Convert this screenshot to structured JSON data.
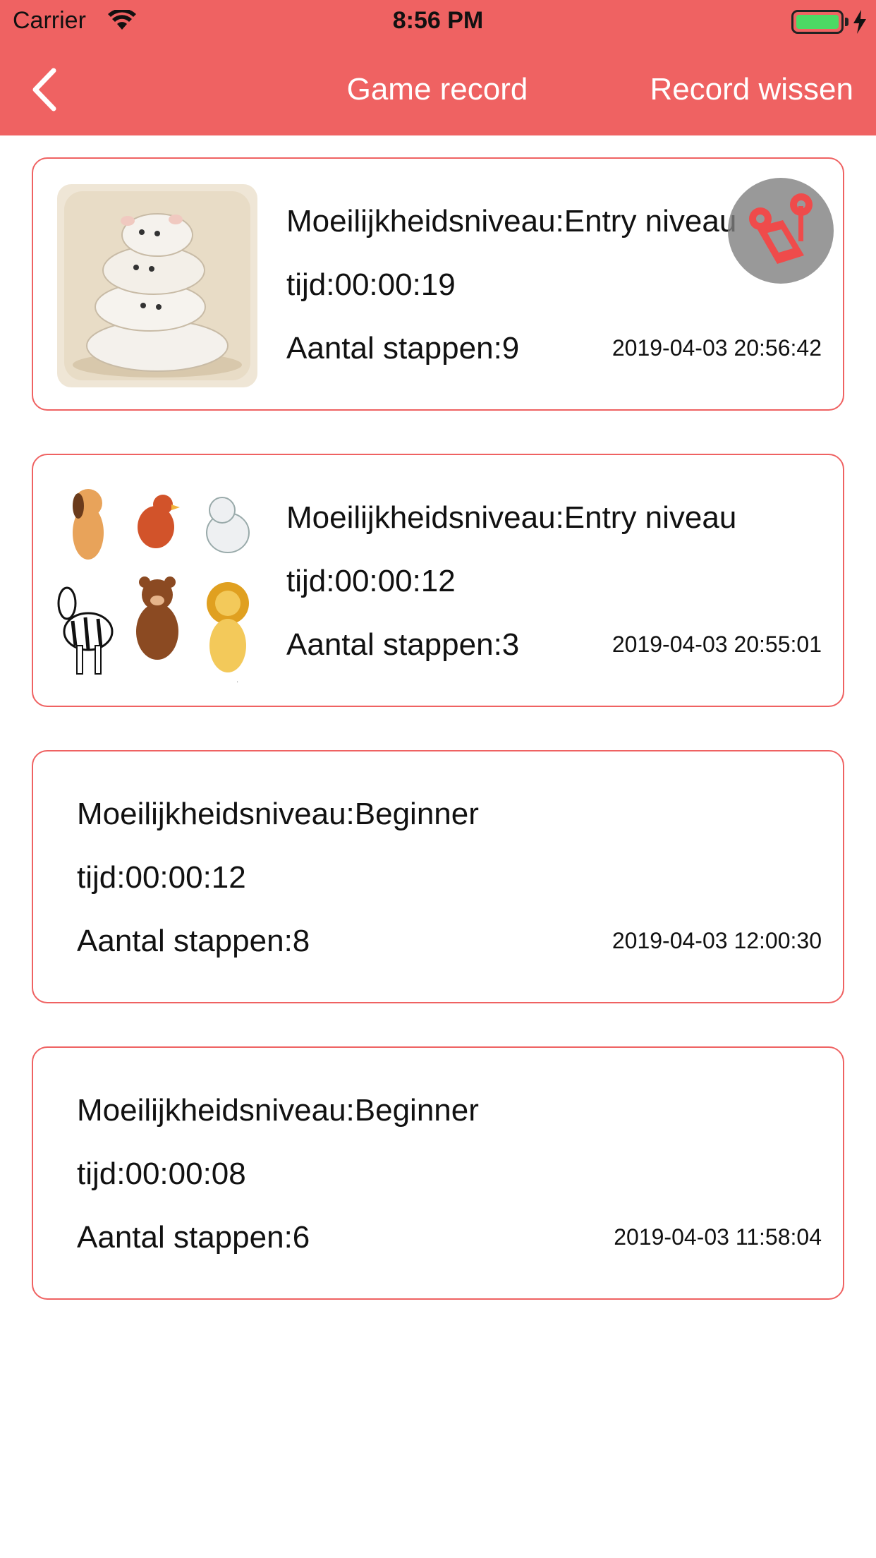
{
  "status_bar": {
    "carrier": "Carrier",
    "time": "8:56 PM",
    "battery_color": "#4cd964"
  },
  "navbar": {
    "title": "Game record",
    "action_label": "Record wissen",
    "back_icon": "chevron-left-icon",
    "background": "#ef6262"
  },
  "records": [
    {
      "difficulty": "Moeilijkheidsniveau:Entry niveau",
      "time": "tijd:00:00:19",
      "steps": "Aantal stappen:9",
      "date": "2019-04-03 20:56:42",
      "image": "hamsters-image"
    },
    {
      "difficulty": "Moeilijkheidsniveau:Entry niveau",
      "time": "tijd:00:00:12",
      "steps": "Aantal stappen:3",
      "date": "2019-04-03 20:55:01",
      "image": "animals-image"
    },
    {
      "difficulty": "Moeilijkheidsniveau:Beginner",
      "time": "tijd:00:00:12",
      "steps": "Aantal stappen:8",
      "date": "2019-04-03 12:00:30",
      "image": null
    },
    {
      "difficulty": "Moeilijkheidsniveau:Beginner",
      "time": "tijd:00:00:08",
      "steps": "Aantal stappen:6",
      "date": "2019-04-03 11:58:04",
      "image": null
    }
  ],
  "floating_button": {
    "icon": "music-note-icon"
  }
}
